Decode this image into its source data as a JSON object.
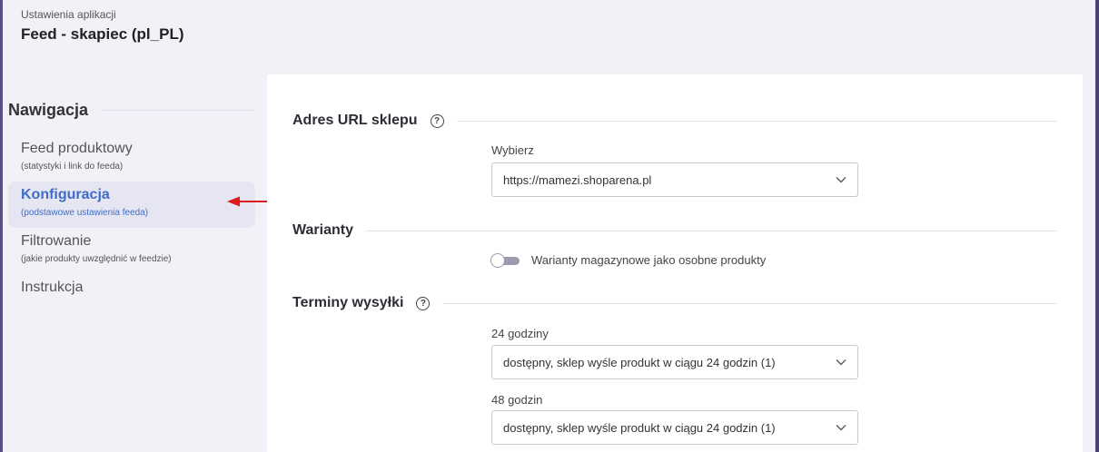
{
  "header": {
    "subtitle": "Ustawienia aplikacji",
    "title": "Feed - skapiec (pl_PL)"
  },
  "nav": {
    "heading": "Nawigacja",
    "items": [
      {
        "label": "Feed produktowy",
        "hint": "(statystyki i link do feeda)",
        "active": false
      },
      {
        "label": "Konfiguracja",
        "hint": "(podstawowe ustawienia feeda)",
        "active": true
      },
      {
        "label": "Filtrowanie",
        "hint": "(jakie produkty uwzględnić w feedzie)",
        "active": false
      },
      {
        "label": "Instrukcja",
        "hint": "",
        "active": false
      }
    ]
  },
  "sections": {
    "url": {
      "title": "Adres URL sklepu",
      "field_label": "Wybierz",
      "value": "https://mamezi.shoparena.pl"
    },
    "variants": {
      "title": "Warianty",
      "toggle_label": "Warianty magazynowe jako osobne produkty",
      "toggle_on": false
    },
    "shipping": {
      "title": "Terminy wysyłki",
      "fields": [
        {
          "label": "24 godziny",
          "value": "dostępny, sklep wyśle produkt w ciągu 24 godzin (1)"
        },
        {
          "label": "48 godzin",
          "value": "dostępny, sklep wyśle produkt w ciągu 24 godzin (1)"
        }
      ]
    }
  },
  "icons": {
    "help": "help-circle-icon",
    "chevron": "chevron-down-icon",
    "annotation": "red-arrow-icon"
  },
  "colors": {
    "accent": "#3f6cc8",
    "annotation": "#e01919",
    "sidebar_bg": "#f1f1f8"
  }
}
